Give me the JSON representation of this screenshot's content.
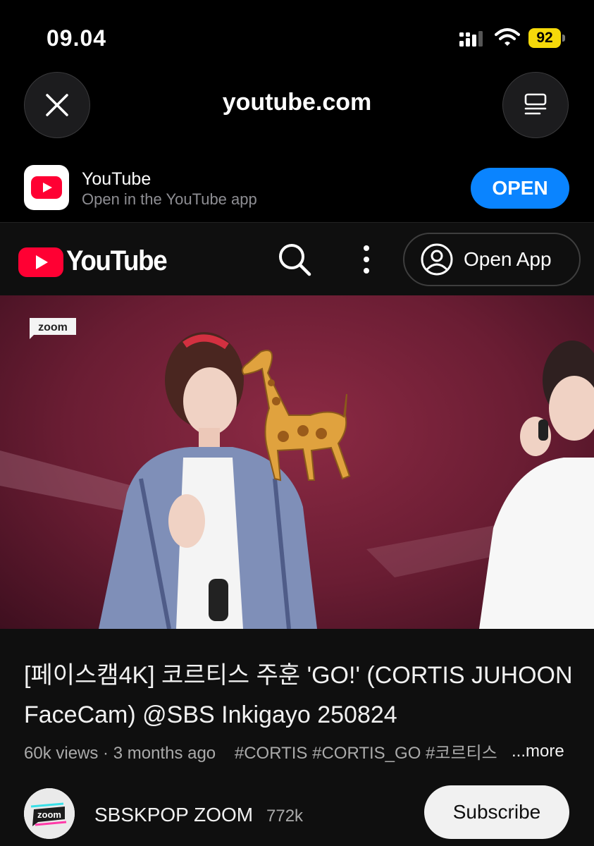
{
  "status_bar": {
    "time": "09.04",
    "battery": "92"
  },
  "browser": {
    "url": "youtube.com"
  },
  "app_banner": {
    "app_name": "YouTube",
    "subtitle": "Open in the YouTube app",
    "open_label": "OPEN"
  },
  "yt_header": {
    "logo_text": "YouTube",
    "open_app_label": "Open App"
  },
  "video": {
    "title": "[페이스캠4K] 코르티스 주훈 'GO!' (CORTIS JUHOON FaceCam) @SBS Inkigayo 250824",
    "views": "60k views",
    "age": "3 months ago",
    "hashtags": "#CORTIS #CORTIS_GO #코르티스",
    "more_label": "...more",
    "overlay_logo": "zoom"
  },
  "channel": {
    "name": "SBSKPOP ZOOM",
    "subscribers": "772k",
    "subscribe_label": "Subscribe",
    "avatar_text": "zoom"
  },
  "colors": {
    "accent_blue": "#0a84ff",
    "youtube_red": "#ff0033",
    "battery_yellow": "#f5d90a"
  }
}
